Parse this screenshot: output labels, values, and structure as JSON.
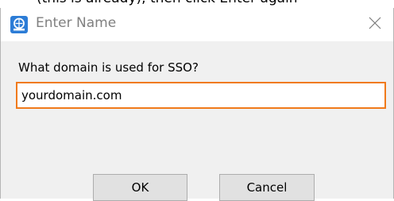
{
  "window": {
    "title": "Enter Name",
    "app_icon": "app-logo-icon",
    "close_icon": "close-icon",
    "clipped_text_above": "(this is already), then click Enter again"
  },
  "form": {
    "prompt": "What domain is used for SSO?",
    "domain_value": "yourdomain.com"
  },
  "buttons": {
    "ok_label": "OK",
    "cancel_label": "Cancel"
  },
  "colors": {
    "focus_border": "#f07a1a",
    "icon_blue": "#2c7cd6",
    "dialog_bg": "#f0f0f0"
  }
}
